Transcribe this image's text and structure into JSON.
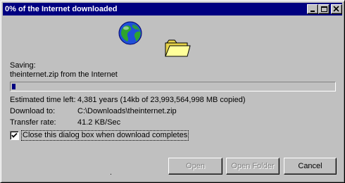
{
  "window": {
    "title": "0% of the Internet downloaded"
  },
  "status": {
    "saving_label": "Saving:",
    "file_source": "theinternet.zip from the Internet"
  },
  "progress": {
    "percent": 1
  },
  "details": {
    "time_left_label": "Estimated time left:",
    "time_left_value": "4,381 years (14kb of 23,993,564,998 MB copied)",
    "download_to_label": "Download to:",
    "download_to_value": "C:\\Downloads\\theinternet.zip",
    "transfer_rate_label": "Transfer rate:",
    "transfer_rate_value": "41.2 KB/Sec"
  },
  "options": {
    "close_when_done_label": "Close this dialog box when download completes",
    "close_when_done_checked": true
  },
  "buttons": {
    "open_label": "Open",
    "open_folder_label": "Open Folder",
    "cancel_label": "Cancel"
  },
  "colors": {
    "titlebar": "#000080",
    "progress_fill": "#000080",
    "face": "#c0c0c0"
  },
  "icons": {
    "globe": "globe-icon",
    "folder": "folder-icon"
  }
}
